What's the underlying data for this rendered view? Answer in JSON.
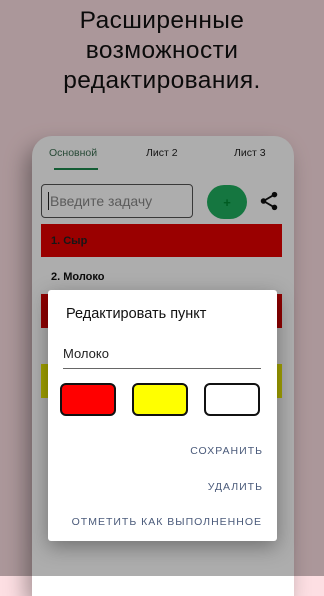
{
  "headline": {
    "line1": "Расширенные",
    "line2": "возможности",
    "line3": "редактирования."
  },
  "tabs": [
    {
      "label": "Основной"
    },
    {
      "label": "Лист 2"
    },
    {
      "label": "Лист 3"
    }
  ],
  "task_input": {
    "placeholder": "Введите задачу",
    "value": ""
  },
  "add_button": {
    "label": "+"
  },
  "share_icon": "share-icon",
  "items": [
    {
      "label": "1. Сыр",
      "color": "#e30000"
    },
    {
      "label": "2. Молоко",
      "color": "#ffffff"
    },
    {
      "label": "",
      "color": "#d40000"
    },
    {
      "label": "",
      "color": "#eeee00"
    }
  ],
  "dialog": {
    "title": "Редактировать пункт",
    "field_value": "Молоко",
    "colors": [
      "#ff0000",
      "#ffff00",
      "#ffffff"
    ],
    "save_label": "СОХРАНИТЬ",
    "delete_label": "УДАЛИТЬ",
    "mark_done_label": "ОТМЕТИТЬ КАК ВЫПОЛНЕННОЕ"
  },
  "theme": {
    "background": "#fddfe3",
    "accent": "#1fae5f",
    "dialog_button_color": "#4a5a7a"
  }
}
